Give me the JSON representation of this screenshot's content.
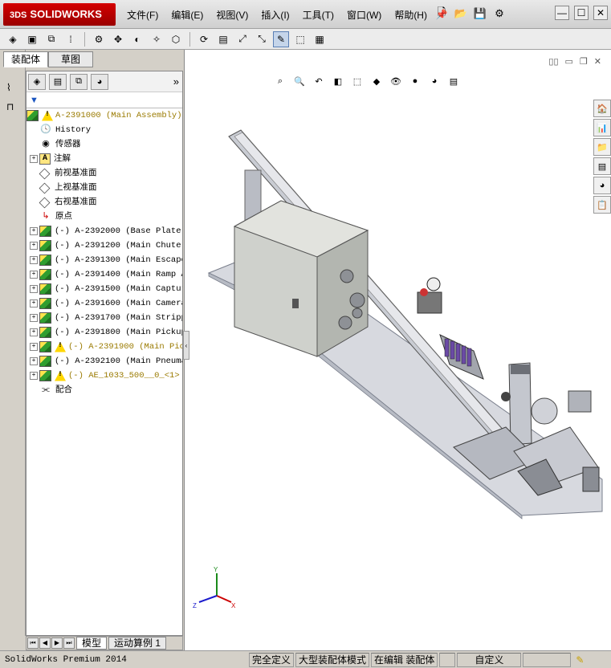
{
  "app": {
    "logo_text": "SOLIDWORKS",
    "logo_prefix": "3DS"
  },
  "menu": [
    {
      "label": "文件(F)"
    },
    {
      "label": "编辑(E)"
    },
    {
      "label": "视图(V)"
    },
    {
      "label": "插入(I)"
    },
    {
      "label": "工具(T)"
    },
    {
      "label": "窗口(W)"
    },
    {
      "label": "帮助(H)"
    }
  ],
  "panel_tabs": [
    {
      "label": "装配体"
    },
    {
      "label": "草图"
    }
  ],
  "tree": {
    "root": "A-2391000  (Main Assembly)",
    "items": [
      {
        "label": "History",
        "icon": "history-icon"
      },
      {
        "label": "传感器",
        "icon": "sensor-icon"
      },
      {
        "label": "注解",
        "icon": "annotation-icon"
      },
      {
        "label": "前视基准面",
        "icon": "plane-icon"
      },
      {
        "label": "上视基准面",
        "icon": "plane-icon"
      },
      {
        "label": "右视基准面",
        "icon": "plane-icon"
      },
      {
        "label": "原点",
        "icon": "origin-icon"
      },
      {
        "label": "(-) A-2392000  (Base Plate"
      },
      {
        "label": "(-) A-2391200  (Main Chute"
      },
      {
        "label": "(-) A-2391300  (Main Escape"
      },
      {
        "label": "(-) A-2391400  (Main Ramp A"
      },
      {
        "label": "(-) A-2391500  (Main Captur"
      },
      {
        "label": "(-) A-2391600  (Main Camera"
      },
      {
        "label": "(-) A-2391700  (Main Stripp"
      },
      {
        "label": "(-) A-2391800  (Main Pickup"
      },
      {
        "label": "(-) A-2391900  (Main Pic"
      },
      {
        "label": "(-) A-2392100  (Main Pneuma"
      },
      {
        "label": "(-) AE_1033_500__0_<1>"
      },
      {
        "label": "配合",
        "icon": "mates-icon"
      }
    ]
  },
  "bottom_tabs": [
    {
      "label": "模型"
    },
    {
      "label": "运动算例 1"
    }
  ],
  "status": {
    "app_name": "SolidWorks Premium 2014",
    "fully_defined": "完全定义",
    "large_assembly": "大型装配体模式",
    "editing": "在编辑 装配体",
    "custom": "自定义"
  },
  "colors": {
    "accent": "#d40000",
    "warning": "#ffd700",
    "component": "#2f9e2f"
  }
}
